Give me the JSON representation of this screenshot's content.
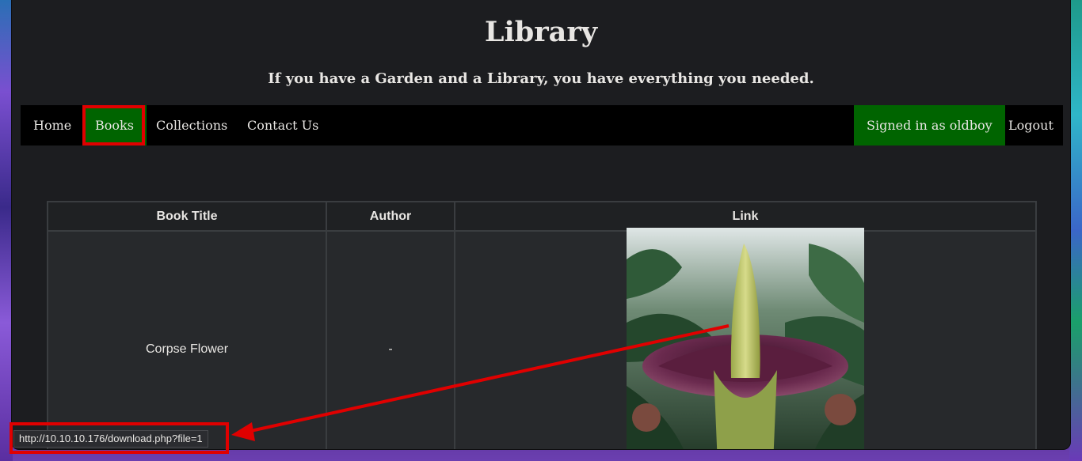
{
  "site": {
    "title": "Library",
    "tagline": "If you have a Garden and a Library, you have everything you needed."
  },
  "nav": {
    "home": "Home",
    "books": "Books",
    "collections": "Collections",
    "contact": "Contact Us",
    "signed_in": "Signed in as oldboy",
    "logout": "Logout"
  },
  "table": {
    "headers": [
      "Book Title",
      "Author",
      "Link"
    ],
    "rows": [
      {
        "title": "Corpse Flower",
        "author": "-",
        "link_image": "corpse-flower-image"
      }
    ]
  },
  "status_bar": {
    "url": "http://10.10.10.176/download.php?file=1"
  },
  "colors": {
    "page_bg": "#1c1d20",
    "nav_bg": "#000000",
    "nav_active": "#006400",
    "annotation_red": "#e00000",
    "table_border": "#3a3d40"
  }
}
